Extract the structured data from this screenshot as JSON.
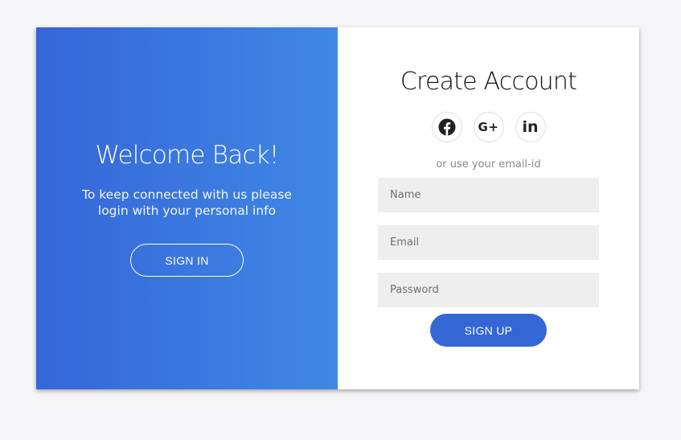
{
  "colors": {
    "overlay_gradient_start": "#3566d8",
    "overlay_gradient_end": "#3f88e5",
    "primary_button": "#3566d6",
    "input_background": "#eeeeee",
    "page_background": "#f5f5f7"
  },
  "overlay": {
    "title": "Welcome Back!",
    "message": "To keep connected with us please login with your personal info",
    "sign_in_label": "SIGN IN"
  },
  "form": {
    "title": "Create Account",
    "social": [
      {
        "icon": "facebook-icon"
      },
      {
        "icon": "google-plus-icon",
        "text": "G+"
      },
      {
        "icon": "linkedin-icon",
        "text": "in"
      }
    ],
    "alt_text": "or use your email-id",
    "name_placeholder": "Name",
    "email_placeholder": "Email",
    "password_placeholder": "Password",
    "sign_up_label": "SIGN UP"
  }
}
